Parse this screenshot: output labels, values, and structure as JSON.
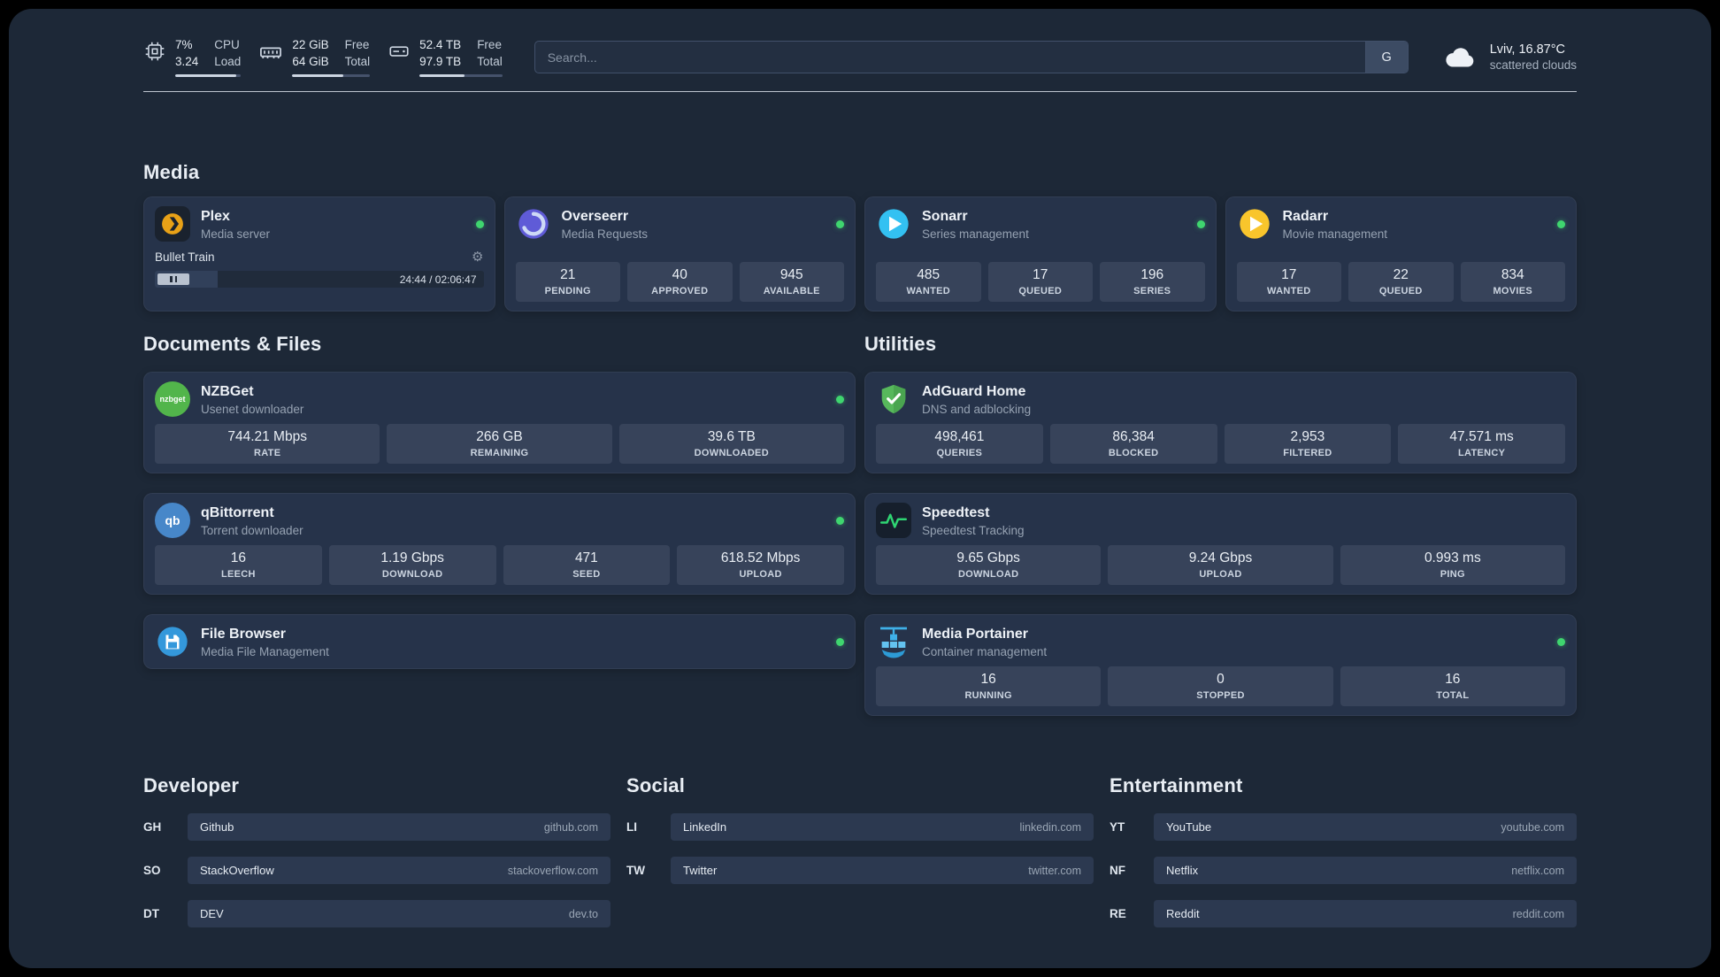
{
  "header": {
    "metrics": {
      "cpu": {
        "value1": "7%",
        "value2": "3.24",
        "label1": "CPU",
        "label2": "Load",
        "bar": "93%"
      },
      "ram": {
        "value1": "22 GiB",
        "value2": "64 GiB",
        "label1": "Free",
        "label2": "Total",
        "bar": "66%"
      },
      "disk": {
        "value1": "52.4 TB",
        "value2": "97.9 TB",
        "label1": "Free",
        "label2": "Total",
        "bar": "54%"
      }
    },
    "search": {
      "placeholder": "Search...",
      "button_label": "G"
    },
    "weather": {
      "location": "Lviv, 16.87°C",
      "condition": "scattered clouds"
    }
  },
  "media": {
    "title": "Media",
    "plex": {
      "name": "Plex",
      "subtitle": "Media server",
      "now_playing": "Bullet Train",
      "elapsed_total": "24:44 / 02:06:47",
      "progress": "19%"
    },
    "overseerr": {
      "name": "Overseerr",
      "subtitle": "Media Requests",
      "stats": [
        {
          "value": "21",
          "label": "PENDING"
        },
        {
          "value": "40",
          "label": "APPROVED"
        },
        {
          "value": "945",
          "label": "AVAILABLE"
        }
      ]
    },
    "sonarr": {
      "name": "Sonarr",
      "subtitle": "Series management",
      "stats": [
        {
          "value": "485",
          "label": "WANTED"
        },
        {
          "value": "17",
          "label": "QUEUED"
        },
        {
          "value": "196",
          "label": "SERIES"
        }
      ]
    },
    "radarr": {
      "name": "Radarr",
      "subtitle": "Movie management",
      "stats": [
        {
          "value": "17",
          "label": "WANTED"
        },
        {
          "value": "22",
          "label": "QUEUED"
        },
        {
          "value": "834",
          "label": "MOVIES"
        }
      ]
    }
  },
  "documents": {
    "title": "Documents & Files",
    "nzbget": {
      "name": "NZBGet",
      "subtitle": "Usenet downloader",
      "icon_text": "nzbget",
      "stats": [
        {
          "value": "744.21 Mbps",
          "label": "RATE"
        },
        {
          "value": "266 GB",
          "label": "REMAINING"
        },
        {
          "value": "39.6 TB",
          "label": "DOWNLOADED"
        }
      ]
    },
    "qbittorrent": {
      "name": "qBittorrent",
      "subtitle": "Torrent downloader",
      "icon_text": "qb",
      "stats": [
        {
          "value": "16",
          "label": "LEECH"
        },
        {
          "value": "1.19 Gbps",
          "label": "DOWNLOAD"
        },
        {
          "value": "471",
          "label": "SEED"
        },
        {
          "value": "618.52 Mbps",
          "label": "UPLOAD"
        }
      ]
    },
    "filebrowser": {
      "name": "File Browser",
      "subtitle": "Media File Management"
    }
  },
  "utilities": {
    "title": "Utilities",
    "adguard": {
      "name": "AdGuard Home",
      "subtitle": "DNS and adblocking",
      "stats": [
        {
          "value": "498,461",
          "label": "QUERIES"
        },
        {
          "value": "86,384",
          "label": "BLOCKED"
        },
        {
          "value": "2,953",
          "label": "FILTERED"
        },
        {
          "value": "47.571 ms",
          "label": "LATENCY"
        }
      ]
    },
    "speedtest": {
      "name": "Speedtest",
      "subtitle": "Speedtest Tracking",
      "stats": [
        {
          "value": "9.65 Gbps",
          "label": "DOWNLOAD"
        },
        {
          "value": "9.24 Gbps",
          "label": "UPLOAD"
        },
        {
          "value": "0.993 ms",
          "label": "PING"
        }
      ]
    },
    "portainer": {
      "name": "Media Portainer",
      "subtitle": "Container management",
      "stats": [
        {
          "value": "16",
          "label": "RUNNING"
        },
        {
          "value": "0",
          "label": "STOPPED"
        },
        {
          "value": "16",
          "label": "TOTAL"
        }
      ]
    }
  },
  "bookmarks": {
    "developer": {
      "title": "Developer",
      "items": [
        {
          "abbr": "GH",
          "name": "Github",
          "domain": "github.com"
        },
        {
          "abbr": "SO",
          "name": "StackOverflow",
          "domain": "stackoverflow.com"
        },
        {
          "abbr": "DT",
          "name": "DEV",
          "domain": "dev.to"
        }
      ]
    },
    "social": {
      "title": "Social",
      "items": [
        {
          "abbr": "LI",
          "name": "LinkedIn",
          "domain": "linkedin.com"
        },
        {
          "abbr": "TW",
          "name": "Twitter",
          "domain": "twitter.com"
        }
      ]
    },
    "entertainment": {
      "title": "Entertainment",
      "items": [
        {
          "abbr": "YT",
          "name": "YouTube",
          "domain": "youtube.com"
        },
        {
          "abbr": "NF",
          "name": "Netflix",
          "domain": "netflix.com"
        },
        {
          "abbr": "RE",
          "name": "Reddit",
          "domain": "reddit.com"
        }
      ]
    }
  },
  "colors": {
    "status_online": "#3fd56f",
    "plex_amber": "#e8a117",
    "overseerr_purple": "#5f5bd7",
    "sonarr_blue": "#33c1f2",
    "radarr_yellow": "#f9c52c",
    "nzbget_green": "#52b54b",
    "qbittorrent_blue": "#4787c9",
    "filebrowser_blue": "#3498db",
    "adguard_green": "#57b85c",
    "speedtest_green": "#2fd573",
    "portainer_blue": "#3fb0e8"
  }
}
